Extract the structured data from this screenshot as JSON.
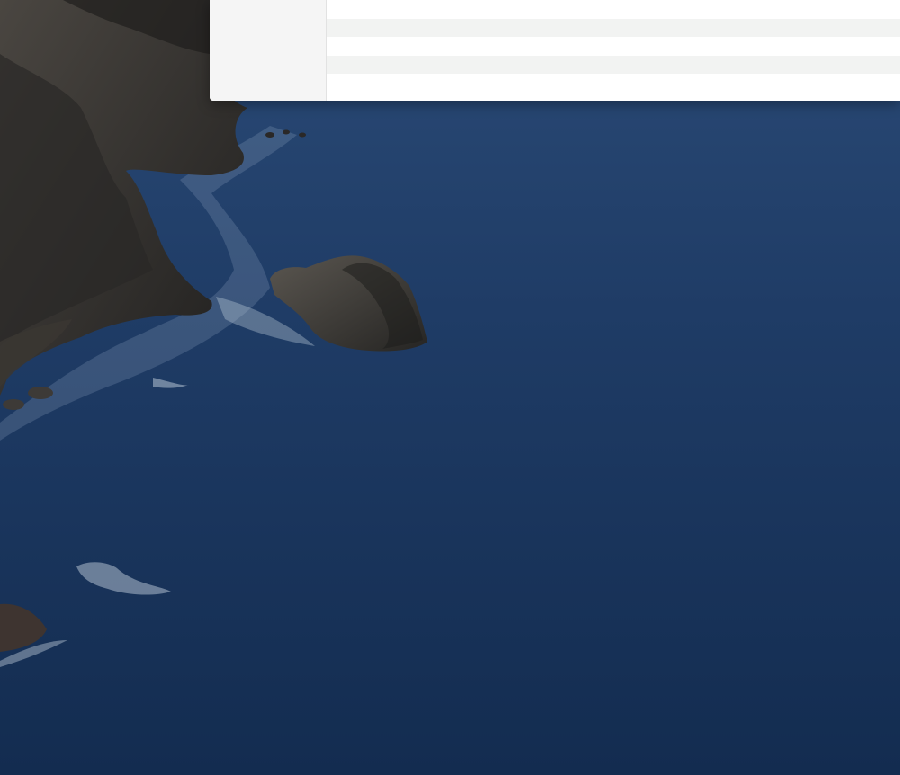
{
  "desktop": {
    "wallpaper": "coastal-cliffs-ocean",
    "colors": {
      "ocean": "#1d3a63",
      "rock": "#2f2d2b",
      "surf": "#c8d4e0"
    }
  },
  "finder_window": {
    "list_rows": [
      "",
      "",
      "",
      "",
      ""
    ]
  }
}
